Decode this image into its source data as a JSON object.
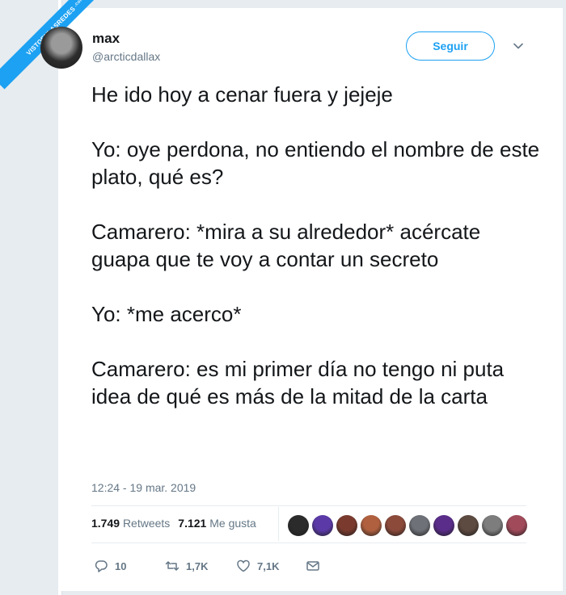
{
  "watermark": {
    "text": "VISTOENLASREDES",
    "sub": ".com"
  },
  "user": {
    "name": "max",
    "handle": "@arcticdallax"
  },
  "follow_label": "Seguir",
  "tweet_paragraphs": [
    "He ido hoy a cenar fuera y jejeje",
    "Yo: oye perdona, no entiendo el nombre de este plato, qué es?",
    "Camarero: *mira a su alrededor* acércate guapa que te voy a contar un secreto",
    "Yo: *me acerco*",
    "Camarero: es mi primer día no tengo ni puta idea de qué es más de la mitad de la carta"
  ],
  "timestamp": "12:24 - 19 mar. 2019",
  "stats": {
    "retweets_count": "1.749",
    "retweets_label": "Retweets",
    "likes_count": "7.121",
    "likes_label": "Me gusta"
  },
  "liker_avatar_colors": [
    "#2b2b2b",
    "#5b3aa8",
    "#7a3b2e",
    "#b0603f",
    "#8b4a3a",
    "#6e7178",
    "#5a2d8a",
    "#5d4a40",
    "#7d7d7d",
    "#a04a5a"
  ],
  "actions": {
    "replies": "10",
    "retweets": "1,7K",
    "likes": "7,1K"
  },
  "colors": {
    "accent": "#1da1f2",
    "muted": "#657786",
    "text": "#14171a"
  }
}
